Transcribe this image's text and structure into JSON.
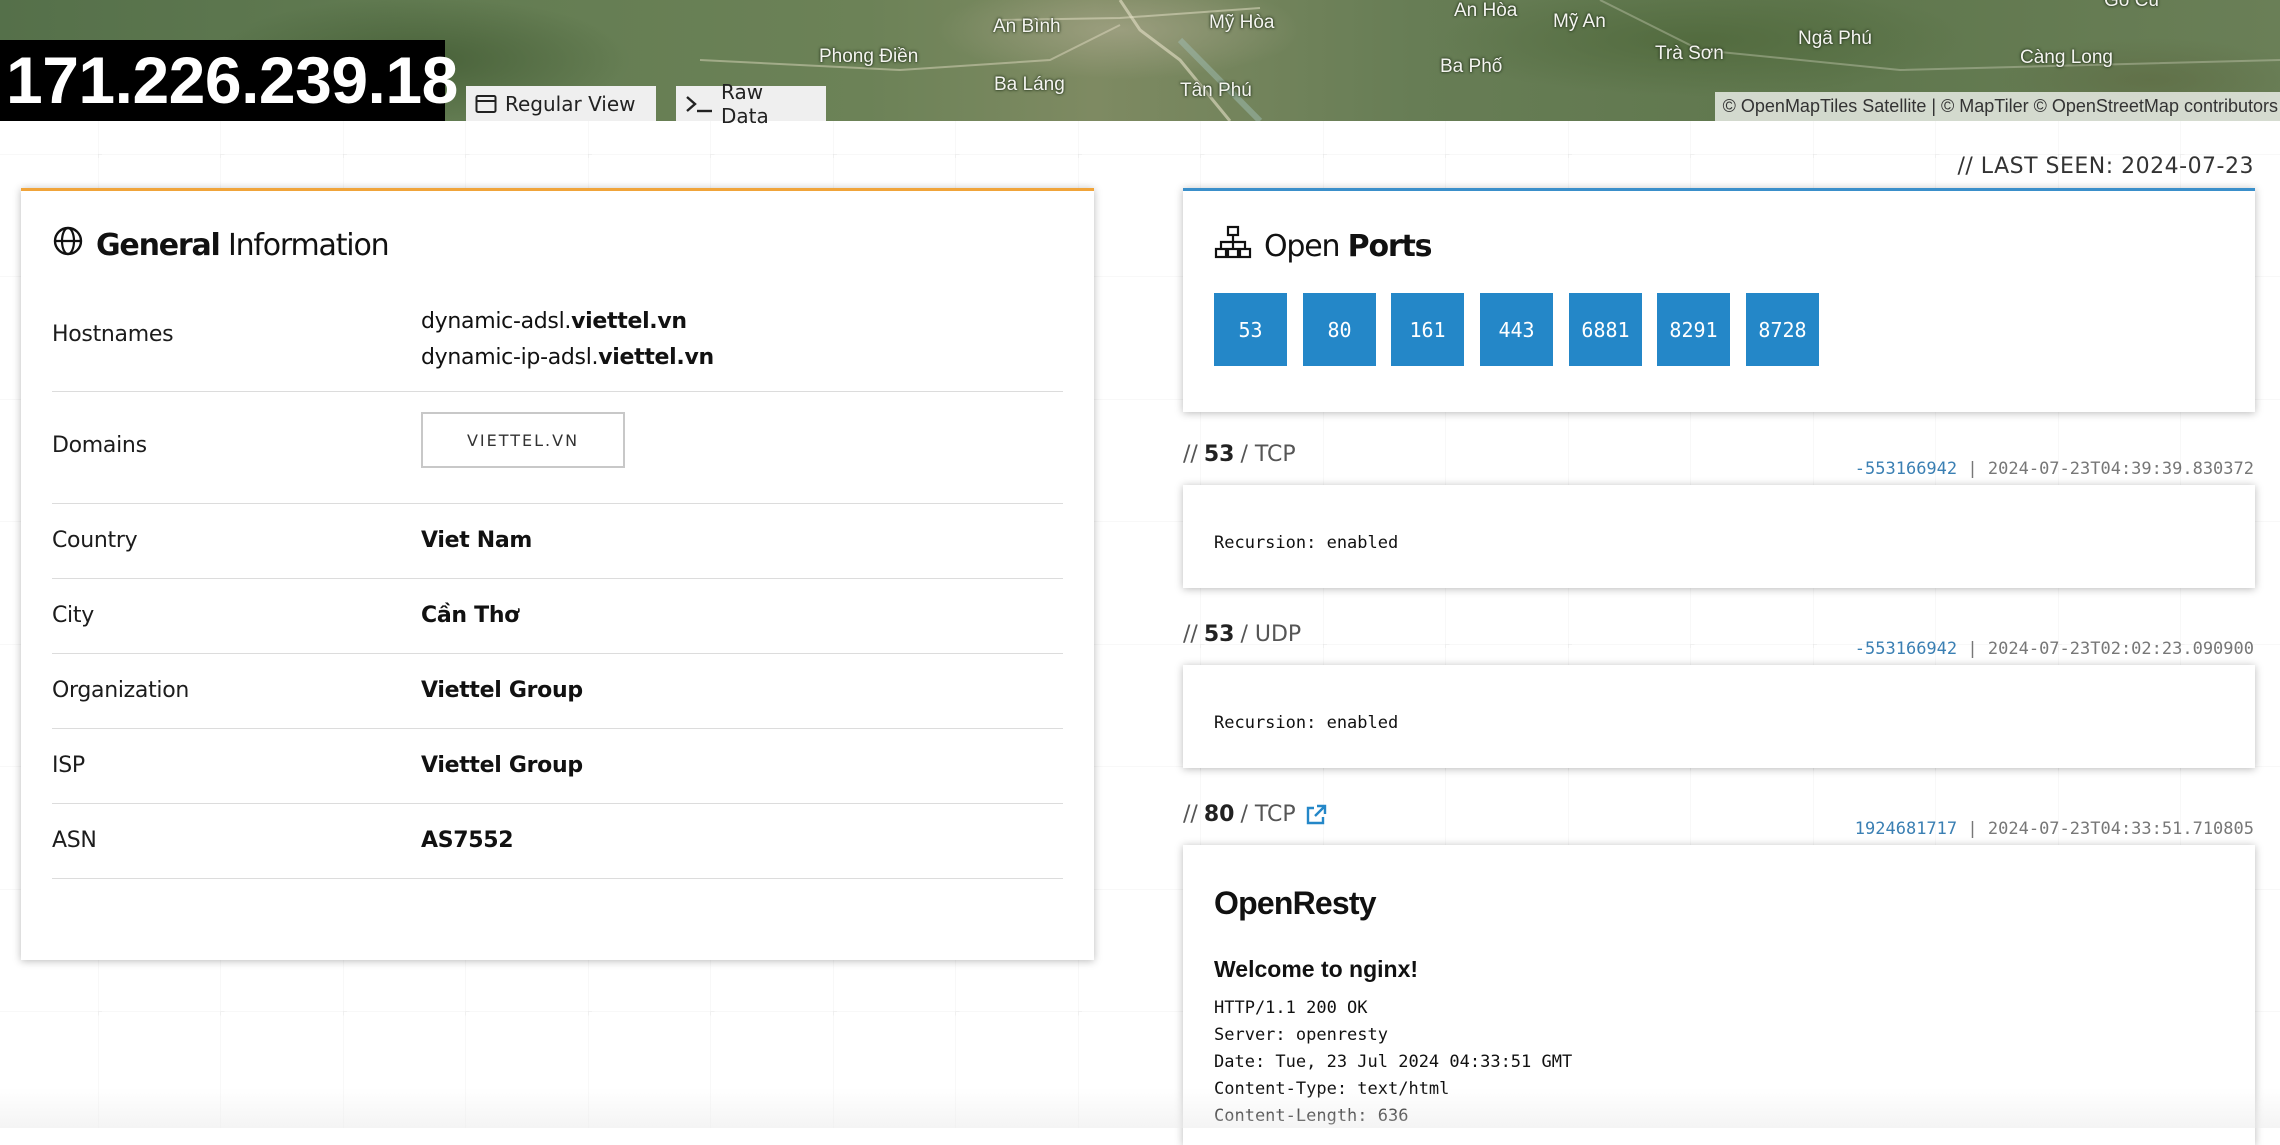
{
  "header": {
    "ip": "171.226.239.18",
    "regular_view_label": "Regular View",
    "raw_data_label": "Raw Data",
    "attribution": "© OpenMapTiles Satellite | © MapTiler © OpenStreetMap contributors",
    "map_labels": [
      "An Bình",
      "Mỹ Hòa",
      "An Hòa",
      "Mỹ An",
      "Gò Cũ",
      "Phong Điền",
      "Ngã Phú",
      "Trà Sơn",
      "Càng Long",
      "Ba Láng",
      "Tân Phú",
      "Ba Phố"
    ]
  },
  "general": {
    "title_bold": "General",
    "title_light": "Information",
    "hostnames_label": "Hostnames",
    "hostnames": [
      {
        "prefix": "dynamic-adsl.",
        "domain": "viettel.vn"
      },
      {
        "prefix": "dynamic-ip-adsl.",
        "domain": "viettel.vn"
      }
    ],
    "domains_label": "Domains",
    "domain_tag": "VIETTEL.VN",
    "country_label": "Country",
    "country": "Viet Nam",
    "city_label": "City",
    "city": "Cần Thơ",
    "organization_label": "Organization",
    "organization": "Viettel Group",
    "isp_label": "ISP",
    "isp": "Viettel Group",
    "asn_label": "ASN",
    "asn": "AS7552"
  },
  "last_seen": "// LAST SEEN: 2024-07-23",
  "ports": {
    "title_light": "Open",
    "title_bold": "Ports",
    "list": [
      "53",
      "80",
      "161",
      "443",
      "6881",
      "8291",
      "8728"
    ]
  },
  "services": [
    {
      "prefix": "//",
      "port": "53",
      "proto": "/ TCP",
      "hash": "-553166942",
      "sep": "|",
      "timestamp": "2024-07-23T04:39:39.830372",
      "banner": "Recursion: enabled"
    },
    {
      "prefix": "//",
      "port": "53",
      "proto": "/ UDP",
      "hash": "-553166942",
      "sep": "|",
      "timestamp": "2024-07-23T02:02:23.090900",
      "banner": "Recursion: enabled"
    },
    {
      "prefix": "//",
      "port": "80",
      "proto": "/ TCP",
      "hash": "1924681717",
      "sep": "|",
      "timestamp": "2024-07-23T04:33:51.710805",
      "page_title": "OpenResty",
      "page_heading": "Welcome to nginx!",
      "banner_lines": [
        "HTTP/1.1 200 OK",
        "Server: openresty",
        "Date: Tue, 23 Jul 2024 04:33:51 GMT",
        "Content-Type: text/html",
        "Content-Length: 636"
      ]
    }
  ],
  "colors": {
    "general_accent": "#f0a43a",
    "ports_accent": "#3a8fca",
    "port_button": "#2487c8",
    "hash_link": "#3a7fb3"
  }
}
